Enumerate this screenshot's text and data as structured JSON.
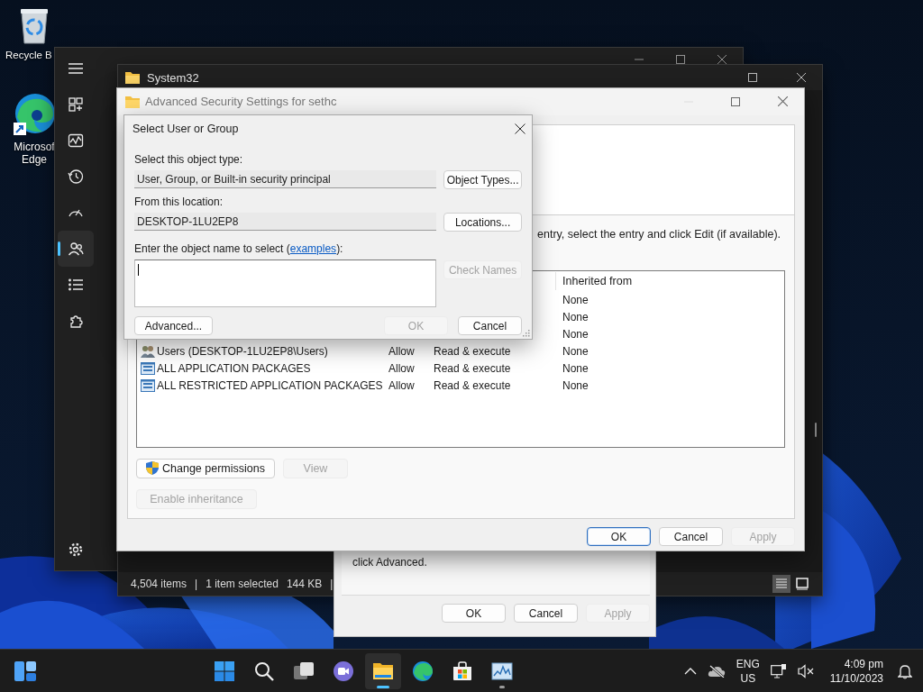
{
  "desktop_icons": [
    {
      "kind": "recycle-bin",
      "lines": [
        "Recycle B"
      ]
    },
    {
      "kind": "edge",
      "lines": [
        "Microsof",
        "Edge"
      ],
      "shortcut": true
    }
  ],
  "task_manager": {
    "nav": [
      {
        "kind": "menu",
        "selected": false
      },
      {
        "kind": "processes",
        "selected": false
      },
      {
        "kind": "performance",
        "selected": false
      },
      {
        "kind": "history",
        "selected": false
      },
      {
        "kind": "startup",
        "selected": false
      },
      {
        "kind": "users",
        "selected": true
      },
      {
        "kind": "details",
        "selected": false
      },
      {
        "kind": "services",
        "selected": false
      },
      {
        "kind": "settings",
        "selected": false
      }
    ]
  },
  "explorer": {
    "title": "System32",
    "status": [
      "4,504 items",
      "|",
      "1 item selected",
      "144 KB",
      "|"
    ],
    "views": [
      {
        "kind": "details",
        "selected": true
      },
      {
        "kind": "tiles",
        "selected": false
      }
    ]
  },
  "properties": {
    "text": "click Advanced.",
    "buttons": [
      {
        "label": "OK",
        "disabled": false
      },
      {
        "label": "Cancel",
        "disabled": false
      },
      {
        "label": "Apply",
        "disabled": true
      }
    ]
  },
  "security": {
    "title": "Advanced Security Settings for sethc",
    "instruction": "entry, select the entry and click Edit (if available).",
    "header": "Inherited from",
    "rows": [
      {
        "inherited_from": "None"
      },
      {
        "inherited_from": "None"
      },
      {
        "inherited_from": "None"
      },
      {
        "kind": "user-group",
        "principal": "Users (DESKTOP-1LU2EP8\\Users)",
        "type": "Allow",
        "access": "Read & execute",
        "inherited_from": "None"
      },
      {
        "kind": "package",
        "principal": "ALL APPLICATION PACKAGES",
        "type": "Allow",
        "access": "Read & execute",
        "inherited_from": "None"
      },
      {
        "kind": "package",
        "principal": "ALL RESTRICTED APPLICATION PACKAGES",
        "type": "Allow",
        "access": "Read & execute",
        "inherited_from": "None"
      }
    ],
    "actions": [
      {
        "label": "Change permissions",
        "disabled": false,
        "shield": true
      },
      {
        "label": "View",
        "disabled": true,
        "shield": false
      }
    ],
    "inheritance_button": {
      "label": "Enable inheritance",
      "disabled": true
    },
    "buttons": [
      {
        "label": "OK",
        "default": true,
        "disabled": false
      },
      {
        "label": "Cancel",
        "default": false,
        "disabled": false
      },
      {
        "label": "Apply",
        "default": false,
        "disabled": true
      }
    ]
  },
  "dialog": {
    "title": "Select User or Group",
    "fields": [
      {
        "label": "Select this object type:",
        "value": "User, Group, or Built-in security principal",
        "button": "Object Types..."
      },
      {
        "label": "From this location:",
        "value": "DESKTOP-1LU2EP8",
        "button": "Locations..."
      }
    ],
    "name_label_before": "Enter the object name to select (",
    "link": "examples",
    "name_label_after": "):",
    "check_names": {
      "label": "Check Names",
      "disabled": true
    },
    "advanced": "Advanced...",
    "buttons": [
      {
        "label": "OK",
        "disabled": true
      },
      {
        "label": "Cancel",
        "disabled": false
      }
    ]
  },
  "taskbar": {
    "apps": [
      {
        "kind": "start",
        "open": false,
        "selected": false
      },
      {
        "kind": "search",
        "open": false,
        "selected": false
      },
      {
        "kind": "task-view",
        "open": false,
        "selected": false
      },
      {
        "kind": "chat",
        "open": false,
        "selected": false
      },
      {
        "kind": "explorer",
        "open": true,
        "selected": true
      },
      {
        "kind": "edge",
        "open": false,
        "selected": false
      },
      {
        "kind": "store",
        "open": false,
        "selected": false
      },
      {
        "kind": "task-manager",
        "open": true,
        "selected": false
      }
    ],
    "tray": {
      "language": "ENG",
      "region": "US",
      "time": "4:09 pm",
      "date": "11/10/2023"
    }
  }
}
